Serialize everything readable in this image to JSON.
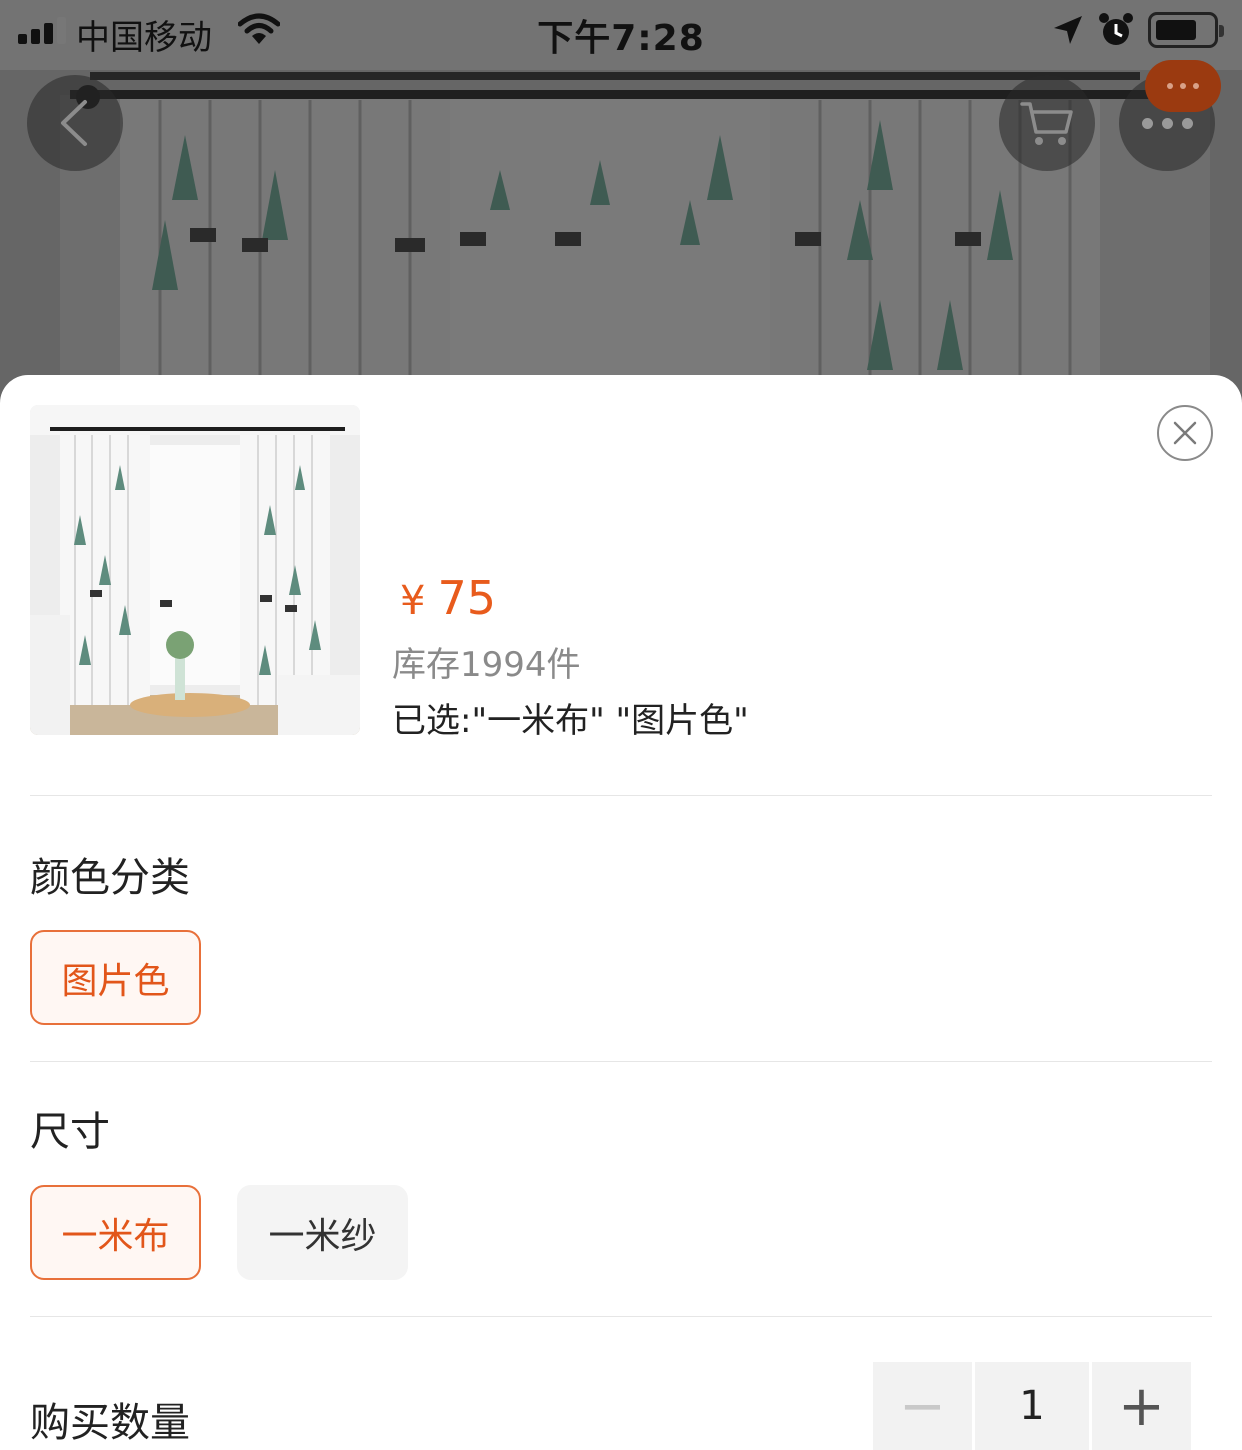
{
  "status_bar": {
    "carrier": "中国移动",
    "time": "下午7:28"
  },
  "icons": {
    "back": "chevron-left-icon",
    "cart": "cart-icon",
    "more": "more-dots-icon",
    "close": "close-icon"
  },
  "product": {
    "currency": "¥",
    "price": "75",
    "stock": "库存1994件",
    "selected": "已选:\"一米布\" \"图片色\""
  },
  "color_section": {
    "title": "颜色分类",
    "options": [
      {
        "label": "图片色",
        "selected": true
      }
    ]
  },
  "size_section": {
    "title": "尺寸",
    "options": [
      {
        "label": "一米布",
        "selected": true
      },
      {
        "label": "一米纱",
        "selected": false
      }
    ]
  },
  "quantity_section": {
    "title": "购买数量",
    "minus": "−",
    "value": "1",
    "plus": "+"
  },
  "colors": {
    "accent": "#e85b1c",
    "option_border": "#e8703a"
  }
}
